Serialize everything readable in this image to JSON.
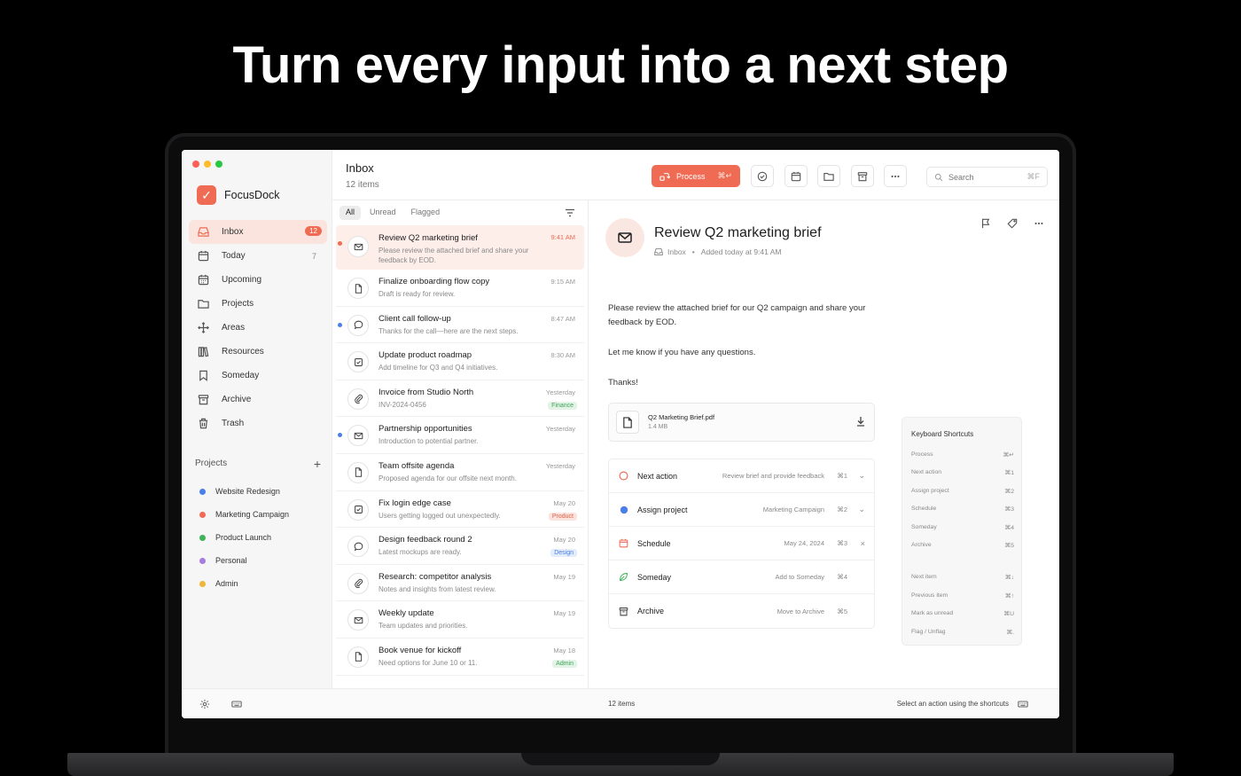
{
  "headline": "Turn every input into a next step",
  "app": {
    "name": "FocusDock",
    "logo_glyph": "✓"
  },
  "sidebar": {
    "items": [
      {
        "label": "Inbox",
        "badge": "12",
        "active": true
      },
      {
        "label": "Today",
        "count": "7"
      },
      {
        "label": "Upcoming"
      },
      {
        "label": "Projects"
      },
      {
        "label": "Areas"
      },
      {
        "label": "Resources"
      },
      {
        "label": "Someday"
      },
      {
        "label": "Archive"
      },
      {
        "label": "Trash"
      }
    ],
    "projects_label": "Projects",
    "projects_add": "+",
    "projects": [
      {
        "label": "Website Redesign",
        "color": "#4a7ee8"
      },
      {
        "label": "Marketing Campaign",
        "color": "#ef6b53"
      },
      {
        "label": "Product Launch",
        "color": "#3fb35b"
      },
      {
        "label": "Personal",
        "color": "#a77ce0"
      },
      {
        "label": "Admin",
        "color": "#f0b43a"
      }
    ]
  },
  "header": {
    "title": "Inbox",
    "count": "12 items",
    "process_label": "Process",
    "process_key": "⌘↵",
    "search_placeholder": "Search",
    "search_key": "⌘F"
  },
  "filters": [
    "All",
    "Unread",
    "Flagged"
  ],
  "list": [
    {
      "title": "Review Q2 marketing brief",
      "preview": "Please review the attached brief and share your feedback by EOD.",
      "time": "9:41 AM",
      "icon": "mail-icon",
      "unread": "#ef6b53",
      "selected": true
    },
    {
      "title": "Finalize onboarding flow copy",
      "preview": "Draft is ready for review.",
      "time": "9:15 AM",
      "icon": "document-icon"
    },
    {
      "title": "Client call follow-up",
      "preview": "Thanks for the call—here are the next steps.",
      "time": "8:47 AM",
      "icon": "chat-icon",
      "unread": "#4a7ee8"
    },
    {
      "title": "Update product roadmap",
      "preview": "Add timeline for Q3 and Q4 initiatives.",
      "time": "8:30 AM",
      "icon": "checkbox-icon"
    },
    {
      "title": "Invoice from Studio North",
      "preview": "INV-2024-0456",
      "time": "Yesterday",
      "icon": "paperclip-icon",
      "tag": "Finance",
      "tag_color": "#3fa35b",
      "tag_bg": "#e3f4e6"
    },
    {
      "title": "Partnership opportunities",
      "preview": "Introduction to potential partner.",
      "time": "Yesterday",
      "icon": "mail-icon",
      "unread": "#4a7ee8"
    },
    {
      "title": "Team offsite agenda",
      "preview": "Proposed agenda for our offsite next month.",
      "time": "Yesterday",
      "icon": "document-icon"
    },
    {
      "title": "Fix login edge case",
      "preview": "Users getting logged out unexpectedly.",
      "time": "May 20",
      "icon": "checkbox-icon",
      "tag": "Product",
      "tag_color": "#e0604a",
      "tag_bg": "#fbe4de"
    },
    {
      "title": "Design feedback round 2",
      "preview": "Latest mockups are ready.",
      "time": "May 20",
      "icon": "chat-icon",
      "tag": "Design",
      "tag_color": "#4a7ee8",
      "tag_bg": "#e3ecfb"
    },
    {
      "title": "Research: competitor analysis",
      "preview": "Notes and insights from latest review.",
      "time": "May 19",
      "icon": "paperclip-icon"
    },
    {
      "title": "Weekly update",
      "preview": "Team updates and priorities.",
      "time": "May 19",
      "icon": "mail-icon"
    },
    {
      "title": "Book venue for kickoff",
      "preview": "Need options for June 10 or 11.",
      "time": "May 18",
      "icon": "document-icon",
      "tag": "Admin",
      "tag_color": "#3fa35b",
      "tag_bg": "#e3f4e6"
    }
  ],
  "detail": {
    "title": "Review Q2 marketing brief",
    "meta_source": "Inbox",
    "meta_sep": "•",
    "meta_time": "Added today at 9:41 AM",
    "body": [
      "Please review the attached brief for our Q2 campaign and share your feedback by EOD.",
      "Let me know if you have any questions.",
      "Thanks!"
    ],
    "attachment": {
      "name": "Q2 Marketing Brief.pdf",
      "size": "1.4 MB"
    },
    "actions": [
      {
        "label": "Next action",
        "desc": "Review brief and provide feedback",
        "key": "⌘1",
        "chev": "⌄",
        "icon": "circle-icon"
      },
      {
        "label": "Assign project",
        "desc": "Marketing Campaign",
        "key": "⌘2",
        "chev": "⌄",
        "icon": "blue-dot-icon"
      },
      {
        "label": "Schedule",
        "desc": "May 24, 2024",
        "key": "⌘3",
        "chev": "×",
        "icon": "calendar-icon"
      },
      {
        "label": "Someday",
        "desc": "Add to Someday",
        "key": "⌘4",
        "chev": "",
        "icon": "leaf-icon"
      },
      {
        "label": "Archive",
        "desc": "Move to Archive",
        "key": "⌘5",
        "chev": "",
        "icon": "archive-icon"
      }
    ]
  },
  "shortcuts": {
    "title": "Keyboard Shortcuts",
    "items": [
      {
        "label": "Process",
        "key": "⌘↵"
      },
      {
        "label": "Next action",
        "key": "⌘1"
      },
      {
        "label": "Assign project",
        "key": "⌘2"
      },
      {
        "label": "Schedule",
        "key": "⌘3"
      },
      {
        "label": "Someday",
        "key": "⌘4"
      },
      {
        "label": "Archive",
        "key": "⌘5"
      },
      {
        "label": "Next item",
        "key": "⌘↓"
      },
      {
        "label": "Previous item",
        "key": "⌘↑"
      },
      {
        "label": "Mark as unread",
        "key": "⌘U"
      },
      {
        "label": "Flag / Unflag",
        "key": "⌘."
      }
    ]
  },
  "footer": {
    "count": "12 items",
    "hint": "Select an action using the shortcuts"
  },
  "colors": {
    "accent": "#ef6b53"
  }
}
